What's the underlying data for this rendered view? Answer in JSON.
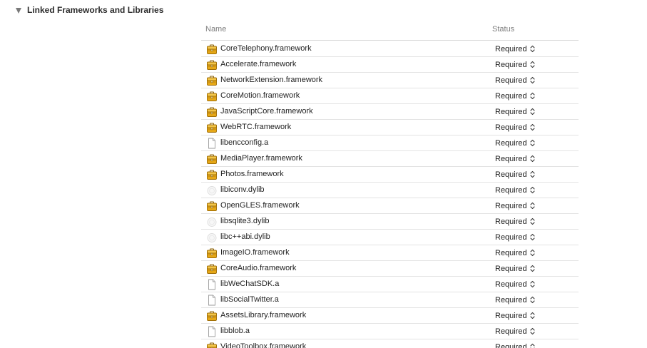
{
  "section": {
    "title": "Linked Frameworks and Libraries"
  },
  "table": {
    "headers": {
      "name": "Name",
      "status": "Status"
    },
    "rows": [
      {
        "name": "CoreTelephony.framework",
        "status": "Required",
        "icon": "framework-icon"
      },
      {
        "name": "Accelerate.framework",
        "status": "Required",
        "icon": "framework-icon"
      },
      {
        "name": "NetworkExtension.framework",
        "status": "Required",
        "icon": "framework-icon"
      },
      {
        "name": "CoreMotion.framework",
        "status": "Required",
        "icon": "framework-icon"
      },
      {
        "name": "JavaScriptCore.framework",
        "status": "Required",
        "icon": "framework-icon"
      },
      {
        "name": "WebRTC.framework",
        "status": "Required",
        "icon": "framework-icon"
      },
      {
        "name": "libencconfig.a",
        "status": "Required",
        "icon": "file-icon"
      },
      {
        "name": "MediaPlayer.framework",
        "status": "Required",
        "icon": "framework-icon"
      },
      {
        "name": "Photos.framework",
        "status": "Required",
        "icon": "framework-icon"
      },
      {
        "name": "libiconv.dylib",
        "status": "Required",
        "icon": "library-icon"
      },
      {
        "name": "OpenGLES.framework",
        "status": "Required",
        "icon": "framework-icon"
      },
      {
        "name": "libsqlite3.dylib",
        "status": "Required",
        "icon": "library-icon"
      },
      {
        "name": "libc++abi.dylib",
        "status": "Required",
        "icon": "library-icon"
      },
      {
        "name": "ImageIO.framework",
        "status": "Required",
        "icon": "framework-icon"
      },
      {
        "name": "CoreAudio.framework",
        "status": "Required",
        "icon": "framework-icon"
      },
      {
        "name": "libWeChatSDK.a",
        "status": "Required",
        "icon": "file-icon"
      },
      {
        "name": "libSocialTwitter.a",
        "status": "Required",
        "icon": "file-icon"
      },
      {
        "name": "AssetsLibrary.framework",
        "status": "Required",
        "icon": "framework-icon"
      },
      {
        "name": "libblob.a",
        "status": "Required",
        "icon": "file-icon"
      },
      {
        "name": "VideoToolbox.framework",
        "status": "Required",
        "icon": "framework-icon"
      }
    ]
  },
  "colors": {
    "framework_icon": "#e6a817",
    "header_text": "#7d7d7d",
    "row_separator": "#e3e3e3"
  }
}
